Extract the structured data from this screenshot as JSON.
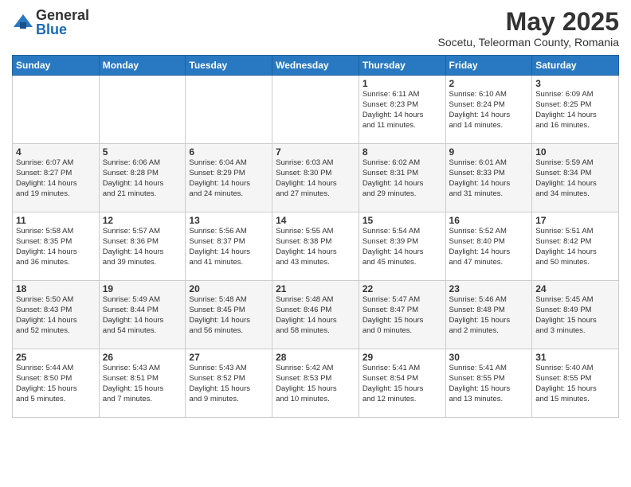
{
  "header": {
    "logo_general": "General",
    "logo_blue": "Blue",
    "month_title": "May 2025",
    "subtitle": "Socetu, Teleorman County, Romania"
  },
  "days_of_week": [
    "Sunday",
    "Monday",
    "Tuesday",
    "Wednesday",
    "Thursday",
    "Friday",
    "Saturday"
  ],
  "weeks": [
    [
      {
        "num": "",
        "info": ""
      },
      {
        "num": "",
        "info": ""
      },
      {
        "num": "",
        "info": ""
      },
      {
        "num": "",
        "info": ""
      },
      {
        "num": "1",
        "info": "Sunrise: 6:11 AM\nSunset: 8:23 PM\nDaylight: 14 hours\nand 11 minutes."
      },
      {
        "num": "2",
        "info": "Sunrise: 6:10 AM\nSunset: 8:24 PM\nDaylight: 14 hours\nand 14 minutes."
      },
      {
        "num": "3",
        "info": "Sunrise: 6:09 AM\nSunset: 8:25 PM\nDaylight: 14 hours\nand 16 minutes."
      }
    ],
    [
      {
        "num": "4",
        "info": "Sunrise: 6:07 AM\nSunset: 8:27 PM\nDaylight: 14 hours\nand 19 minutes."
      },
      {
        "num": "5",
        "info": "Sunrise: 6:06 AM\nSunset: 8:28 PM\nDaylight: 14 hours\nand 21 minutes."
      },
      {
        "num": "6",
        "info": "Sunrise: 6:04 AM\nSunset: 8:29 PM\nDaylight: 14 hours\nand 24 minutes."
      },
      {
        "num": "7",
        "info": "Sunrise: 6:03 AM\nSunset: 8:30 PM\nDaylight: 14 hours\nand 27 minutes."
      },
      {
        "num": "8",
        "info": "Sunrise: 6:02 AM\nSunset: 8:31 PM\nDaylight: 14 hours\nand 29 minutes."
      },
      {
        "num": "9",
        "info": "Sunrise: 6:01 AM\nSunset: 8:33 PM\nDaylight: 14 hours\nand 31 minutes."
      },
      {
        "num": "10",
        "info": "Sunrise: 5:59 AM\nSunset: 8:34 PM\nDaylight: 14 hours\nand 34 minutes."
      }
    ],
    [
      {
        "num": "11",
        "info": "Sunrise: 5:58 AM\nSunset: 8:35 PM\nDaylight: 14 hours\nand 36 minutes."
      },
      {
        "num": "12",
        "info": "Sunrise: 5:57 AM\nSunset: 8:36 PM\nDaylight: 14 hours\nand 39 minutes."
      },
      {
        "num": "13",
        "info": "Sunrise: 5:56 AM\nSunset: 8:37 PM\nDaylight: 14 hours\nand 41 minutes."
      },
      {
        "num": "14",
        "info": "Sunrise: 5:55 AM\nSunset: 8:38 PM\nDaylight: 14 hours\nand 43 minutes."
      },
      {
        "num": "15",
        "info": "Sunrise: 5:54 AM\nSunset: 8:39 PM\nDaylight: 14 hours\nand 45 minutes."
      },
      {
        "num": "16",
        "info": "Sunrise: 5:52 AM\nSunset: 8:40 PM\nDaylight: 14 hours\nand 47 minutes."
      },
      {
        "num": "17",
        "info": "Sunrise: 5:51 AM\nSunset: 8:42 PM\nDaylight: 14 hours\nand 50 minutes."
      }
    ],
    [
      {
        "num": "18",
        "info": "Sunrise: 5:50 AM\nSunset: 8:43 PM\nDaylight: 14 hours\nand 52 minutes."
      },
      {
        "num": "19",
        "info": "Sunrise: 5:49 AM\nSunset: 8:44 PM\nDaylight: 14 hours\nand 54 minutes."
      },
      {
        "num": "20",
        "info": "Sunrise: 5:48 AM\nSunset: 8:45 PM\nDaylight: 14 hours\nand 56 minutes."
      },
      {
        "num": "21",
        "info": "Sunrise: 5:48 AM\nSunset: 8:46 PM\nDaylight: 14 hours\nand 58 minutes."
      },
      {
        "num": "22",
        "info": "Sunrise: 5:47 AM\nSunset: 8:47 PM\nDaylight: 15 hours\nand 0 minutes."
      },
      {
        "num": "23",
        "info": "Sunrise: 5:46 AM\nSunset: 8:48 PM\nDaylight: 15 hours\nand 2 minutes."
      },
      {
        "num": "24",
        "info": "Sunrise: 5:45 AM\nSunset: 8:49 PM\nDaylight: 15 hours\nand 3 minutes."
      }
    ],
    [
      {
        "num": "25",
        "info": "Sunrise: 5:44 AM\nSunset: 8:50 PM\nDaylight: 15 hours\nand 5 minutes."
      },
      {
        "num": "26",
        "info": "Sunrise: 5:43 AM\nSunset: 8:51 PM\nDaylight: 15 hours\nand 7 minutes."
      },
      {
        "num": "27",
        "info": "Sunrise: 5:43 AM\nSunset: 8:52 PM\nDaylight: 15 hours\nand 9 minutes."
      },
      {
        "num": "28",
        "info": "Sunrise: 5:42 AM\nSunset: 8:53 PM\nDaylight: 15 hours\nand 10 minutes."
      },
      {
        "num": "29",
        "info": "Sunrise: 5:41 AM\nSunset: 8:54 PM\nDaylight: 15 hours\nand 12 minutes."
      },
      {
        "num": "30",
        "info": "Sunrise: 5:41 AM\nSunset: 8:55 PM\nDaylight: 15 hours\nand 13 minutes."
      },
      {
        "num": "31",
        "info": "Sunrise: 5:40 AM\nSunset: 8:55 PM\nDaylight: 15 hours\nand 15 minutes."
      }
    ]
  ]
}
